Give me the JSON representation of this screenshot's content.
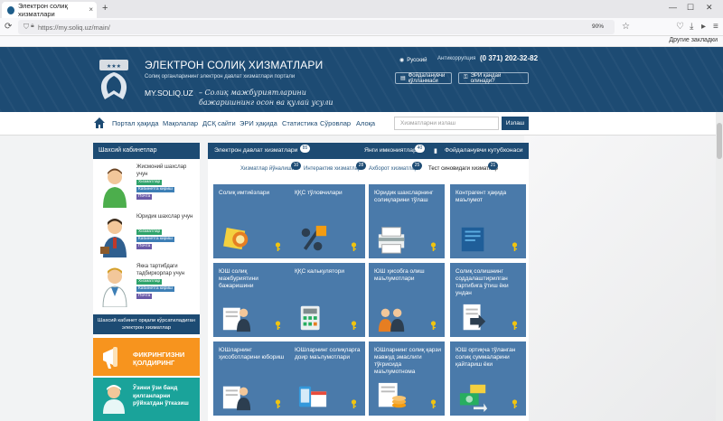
{
  "browser": {
    "tab_title": "Электрон солиқ хизматлари",
    "tab_close": "×",
    "new_tab": "+",
    "url": "https://my.soliq.uz/main/",
    "zoom": "90%",
    "bookmarks_label": "Другие закладки",
    "win_min": "—",
    "win_max": "☐",
    "win_close": "✕"
  },
  "header": {
    "title": "ЭЛЕКТРОН СОЛИҚ ХИЗМАТЛАРИ",
    "subtitle": "Солиқ органларининг электрон давлат хизматлари портали",
    "domain": "MY.SOLIQ.UZ",
    "slogan": "– Солиқ мажбуриятларини бажаришнинг осон ва қулай усули",
    "language": "Русский",
    "phone_label": "Антикоррупция",
    "phone": "(0 371) 202-32-82",
    "manual_button": "Фойдаланувчи қўлланмаси",
    "eri_button": "ЭРИ қандай олинади?"
  },
  "nav": {
    "items": [
      "Портал ҳақида",
      "Мақолалар",
      "ДСҚ сайти",
      "ЭРИ ҳақида",
      "Статистика",
      "Сўровлар",
      "Алоқа"
    ],
    "search_placeholder": "Хизматларни излаш",
    "search_button": "Излаш"
  },
  "sidebar": {
    "title": "Шахсий кабинетлар",
    "persons": [
      {
        "name": "Жисмоний шахслар учун",
        "links": [
          "Хизматлар",
          "Кабинетга кириш",
          "Почта"
        ]
      },
      {
        "name": "Юридик шахслар учун",
        "links": [
          "Хизматлар",
          "Кабинетга кириш",
          "Почта"
        ]
      },
      {
        "name": "Якка тартибдаги тадбиркорлар учун",
        "links": [
          "Хизматлар",
          "Кабинетга кириш",
          "Почта"
        ]
      }
    ],
    "info_box": "Шахсий кабинет орқали кўрсатиладиган электрон хизматлар",
    "orange_box": "ФИКРИНГИЗНИ ҚОЛДИРИНГ",
    "teal_box": "Ўзини ўзи банд қилганларни рўйхатдан ўтказиш"
  },
  "main": {
    "tabs": [
      {
        "label": "Электрон давлат хизматлари",
        "count": "85"
      },
      {
        "label": "Янги имкониятлар",
        "count": "40"
      },
      {
        "label": "Фойдаланувчи кутубхонаси",
        "count": ""
      }
    ],
    "subtabs": [
      {
        "label": "Хизматлар йўналиши",
        "count": "10"
      },
      {
        "label": "Интерактив хизматлар",
        "count": "28"
      },
      {
        "label": "Ахборот хизматлари",
        "count": "25"
      },
      {
        "label": "Тест синовидаги хизматлар",
        "count": "21"
      }
    ],
    "tiles": [
      {
        "title": "Солиқ имтиёзлари",
        "icon": "award-medal-icon"
      },
      {
        "title": "ҚҚС тўловчилари",
        "icon": "percent-icon"
      },
      {
        "title": "Юридик шахсларнинг солиқларини тўлаш",
        "icon": "printer-icon"
      },
      {
        "title": "Контрагент ҳақида маълумот",
        "icon": "contract-icon"
      },
      {
        "title": "ЮШ солиқ мажбуриятини бажаришини",
        "icon": "person-document-icon"
      },
      {
        "title": "ҚҚС калькулятори",
        "icon": "calculator-icon"
      },
      {
        "title": "ЮШ ҳисобга олиш маълумотлари",
        "icon": "people-icon"
      },
      {
        "title": "Солиқ солишнинг соддалаштирилган тартибига ўтиш ёки ундан",
        "icon": "document-arrow-icon"
      },
      {
        "title": "ЮШларнинг ҳисоботларини юбориш",
        "icon": "person-document-icon"
      },
      {
        "title": "ЮШларнинг солиқларга доир маълумотлари",
        "icon": "phone-calendar-icon"
      },
      {
        "title": "ЮШларнинг солиқ қарзи мавжуд эмаслиги тўғрисида маълумотнома",
        "icon": "coins-icon"
      },
      {
        "title": "ЮШ ортиқча тўланган солиқ суммаларини қайтариш ёки",
        "icon": "money-transfer-icon"
      }
    ]
  },
  "colors": {
    "brand": "#1d4b73",
    "tile": "#4a7aaa",
    "orange": "#f7941e",
    "teal": "#1aa39a"
  }
}
